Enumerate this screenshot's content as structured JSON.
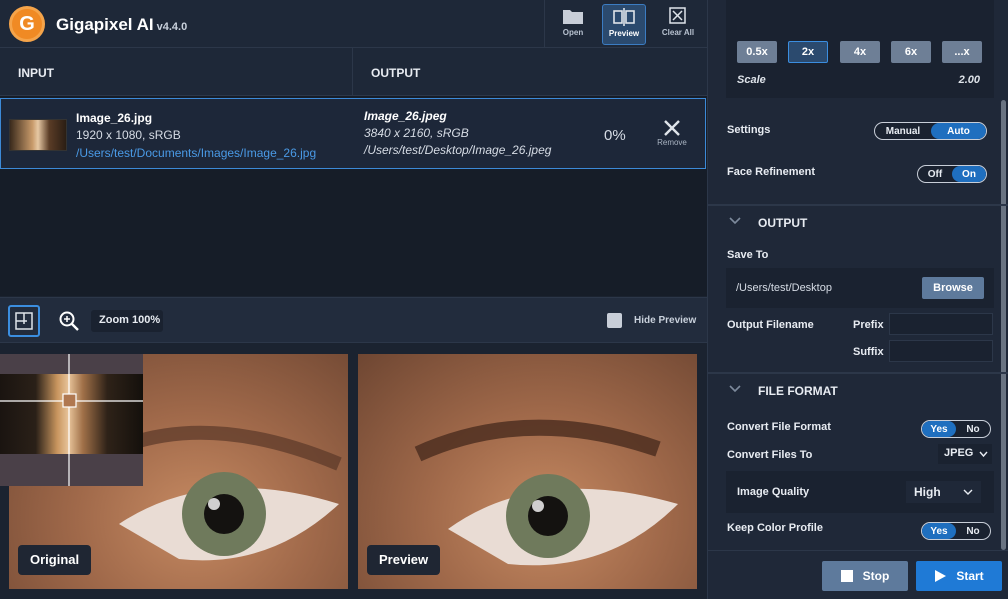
{
  "app": {
    "logo_letter": "G",
    "title": "Gigapixel AI",
    "version": "v4.4.0"
  },
  "toolbar": {
    "open_label": "Open",
    "preview_label": "Preview",
    "clear_label": "Clear All"
  },
  "table": {
    "input_header": "INPUT",
    "output_header": "OUTPUT"
  },
  "file": {
    "input_name": "Image_26.jpg",
    "input_dims": "1920 x 1080, sRGB",
    "input_path": "/Users/test/Documents/Images/Image_26.jpg",
    "output_name": "Image_26.jpeg",
    "output_dims": "3840 x 2160, sRGB",
    "output_path": "/Users/test/Desktop/Image_26.jpeg",
    "progress": "0%",
    "remove_label": "Remove"
  },
  "preview": {
    "zoom": "Zoom 100%",
    "hide_label": "Hide Preview",
    "original_label": "Original",
    "preview_label": "Preview"
  },
  "scale": {
    "options": [
      "0.5x",
      "2x",
      "4x",
      "6x",
      "...x"
    ],
    "selected": "2x",
    "label": "Scale",
    "value": "2.00"
  },
  "settings": {
    "label": "Settings",
    "manual": "Manual",
    "auto": "Auto",
    "face_label": "Face Refinement",
    "off": "Off",
    "on": "On"
  },
  "output_section": {
    "title": "OUTPUT",
    "save_to_label": "Save To",
    "save_path": "/Users/test/Desktop",
    "browse": "Browse",
    "filename_label": "Output Filename",
    "prefix": "Prefix",
    "suffix": "Suffix"
  },
  "format_section": {
    "title": "FILE FORMAT",
    "convert_label": "Convert File Format",
    "yes": "Yes",
    "no": "No",
    "convert_to_label": "Convert Files To",
    "format": "JPEG",
    "quality_label": "Image Quality",
    "quality": "High",
    "keep_profile_label": "Keep Color Profile"
  },
  "actions": {
    "stop": "Stop",
    "start": "Start"
  },
  "colors": {
    "accent": "#1f7ad6",
    "logo": "#f08a24",
    "link": "#4a9ae6"
  }
}
